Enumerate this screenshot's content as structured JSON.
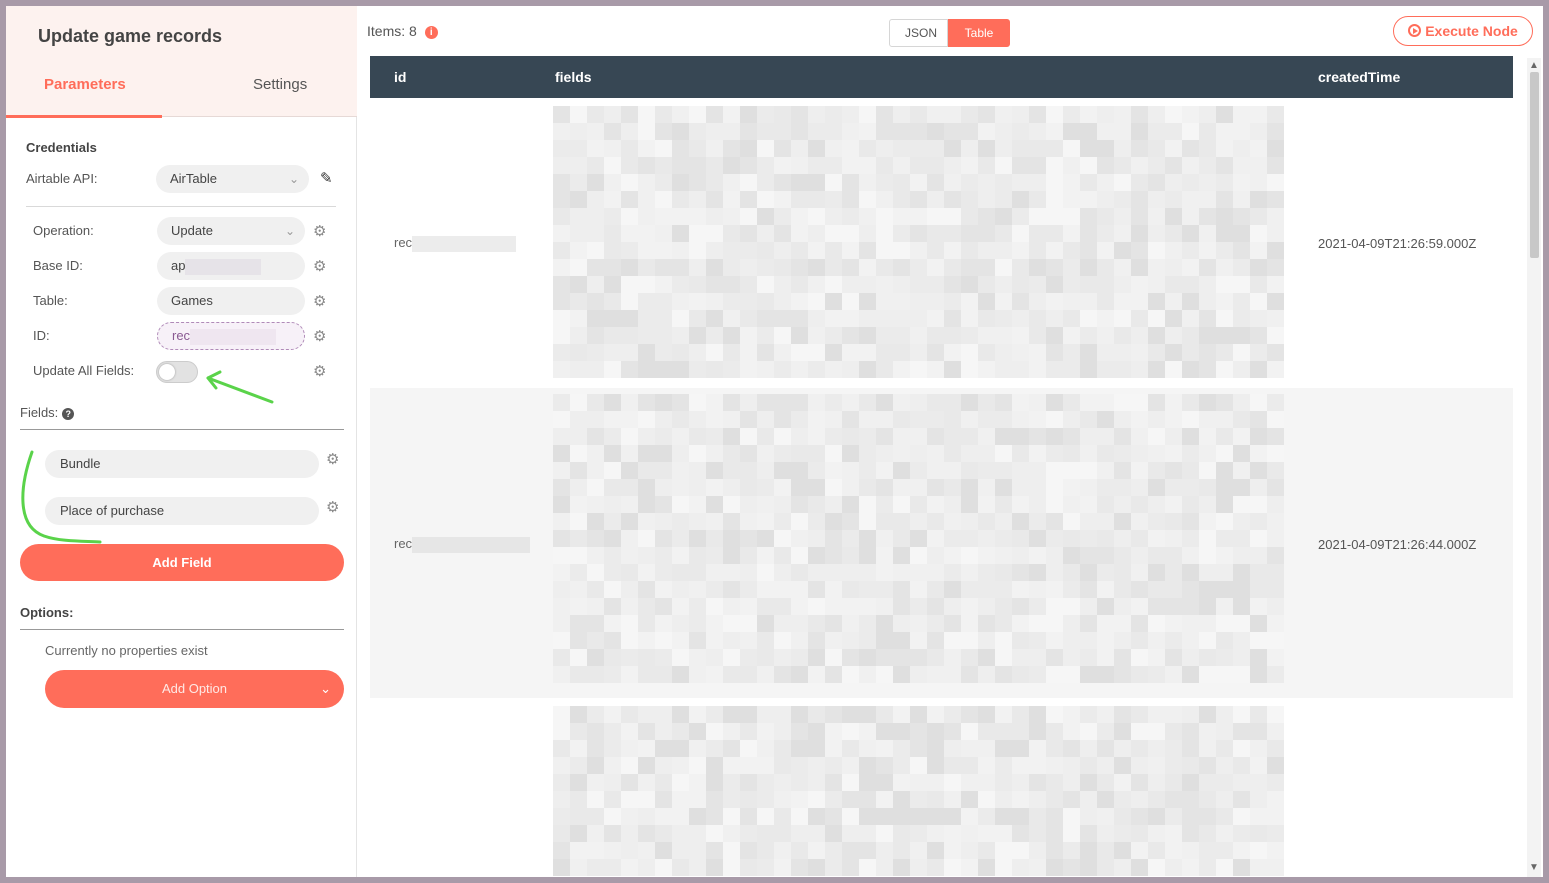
{
  "node": {
    "title": "Update game records"
  },
  "tabs": {
    "parameters": "Parameters",
    "settings": "Settings"
  },
  "credentials": {
    "section": "Credentials",
    "airtable_label": "Airtable API:",
    "airtable_value": "AirTable"
  },
  "params": {
    "operation_label": "Operation:",
    "operation_value": "Update",
    "base_id_label": "Base ID:",
    "base_id_value": "ap",
    "table_label": "Table:",
    "table_value": "Games",
    "id_label": "ID:",
    "id_value": "rec",
    "update_all_label": "Update All Fields:",
    "update_all_on": false
  },
  "fields": {
    "label": "Fields:",
    "items": [
      "Bundle",
      "Place of purchase"
    ],
    "add_label": "Add Field"
  },
  "options": {
    "label": "Options:",
    "empty_text": "Currently no properties exist",
    "add_label": "Add Option"
  },
  "output": {
    "items_label": "Items: 8",
    "view_json": "JSON",
    "view_table": "Table",
    "execute_label": "Execute Node",
    "columns": [
      "id",
      "fields",
      "createdTime"
    ],
    "rows": [
      {
        "id": "rec",
        "created": "2021-04-09T21:26:59.000Z"
      },
      {
        "id": "rec",
        "created": "2021-04-09T21:26:44.000Z"
      },
      {
        "id": "",
        "created": ""
      }
    ]
  },
  "icons": {
    "gear": "gear-icon",
    "pencil": "pencil-icon",
    "help": "help-icon",
    "info": "info-icon",
    "play": "play-icon",
    "chevron": "chevron-down-icon"
  },
  "colors": {
    "accent": "#ff6d5a",
    "table_header": "#374754",
    "annotation": "#5ad34a"
  }
}
